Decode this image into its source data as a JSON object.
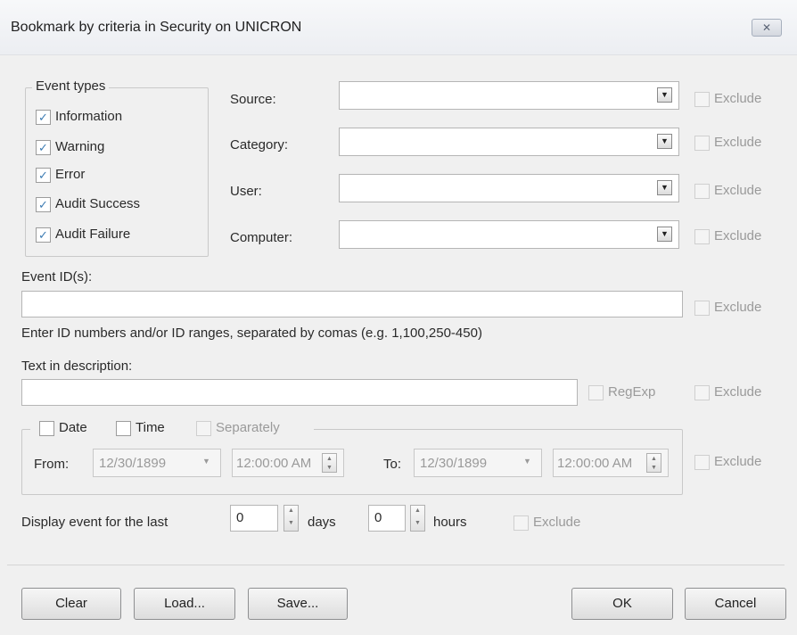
{
  "window": {
    "title": "Bookmark by criteria in Security on UNICRON",
    "close_icon": "✕"
  },
  "event_types": {
    "legend": "Event types",
    "items": [
      {
        "label": "Information",
        "checked": true
      },
      {
        "label": "Warning",
        "checked": true
      },
      {
        "label": "Error",
        "checked": true
      },
      {
        "label": "Audit Success",
        "checked": true
      },
      {
        "label": "Audit Failure",
        "checked": true
      }
    ]
  },
  "filters": {
    "source_label": "Source:",
    "category_label": "Category:",
    "user_label": "User:",
    "computer_label": "Computer:",
    "source_value": "",
    "category_value": "",
    "user_value": "",
    "computer_value": ""
  },
  "exclude_label": "Exclude",
  "check_mark": "✓",
  "event_ids": {
    "label": "Event ID(s):",
    "value": "",
    "hint": "Enter ID numbers and/or ID ranges, separated by comas (e.g. 1,100,250-450)"
  },
  "description": {
    "label": "Text in description:",
    "value": "",
    "regexp_label": "RegExp"
  },
  "date_time": {
    "date_label": "Date",
    "time_label": "Time",
    "separately_label": "Separately",
    "from_label": "From:",
    "to_label": "To:",
    "from_date": "12/30/1899",
    "from_time": "12:00:00 AM",
    "to_date": "12/30/1899",
    "to_time": "12:00:00 AM"
  },
  "last": {
    "label": "Display event for the last",
    "days_value": "0",
    "days_label": "days",
    "hours_value": "0",
    "hours_label": "hours"
  },
  "buttons": {
    "clear": "Clear",
    "load": "Load...",
    "save": "Save...",
    "ok": "OK",
    "cancel": "Cancel"
  }
}
